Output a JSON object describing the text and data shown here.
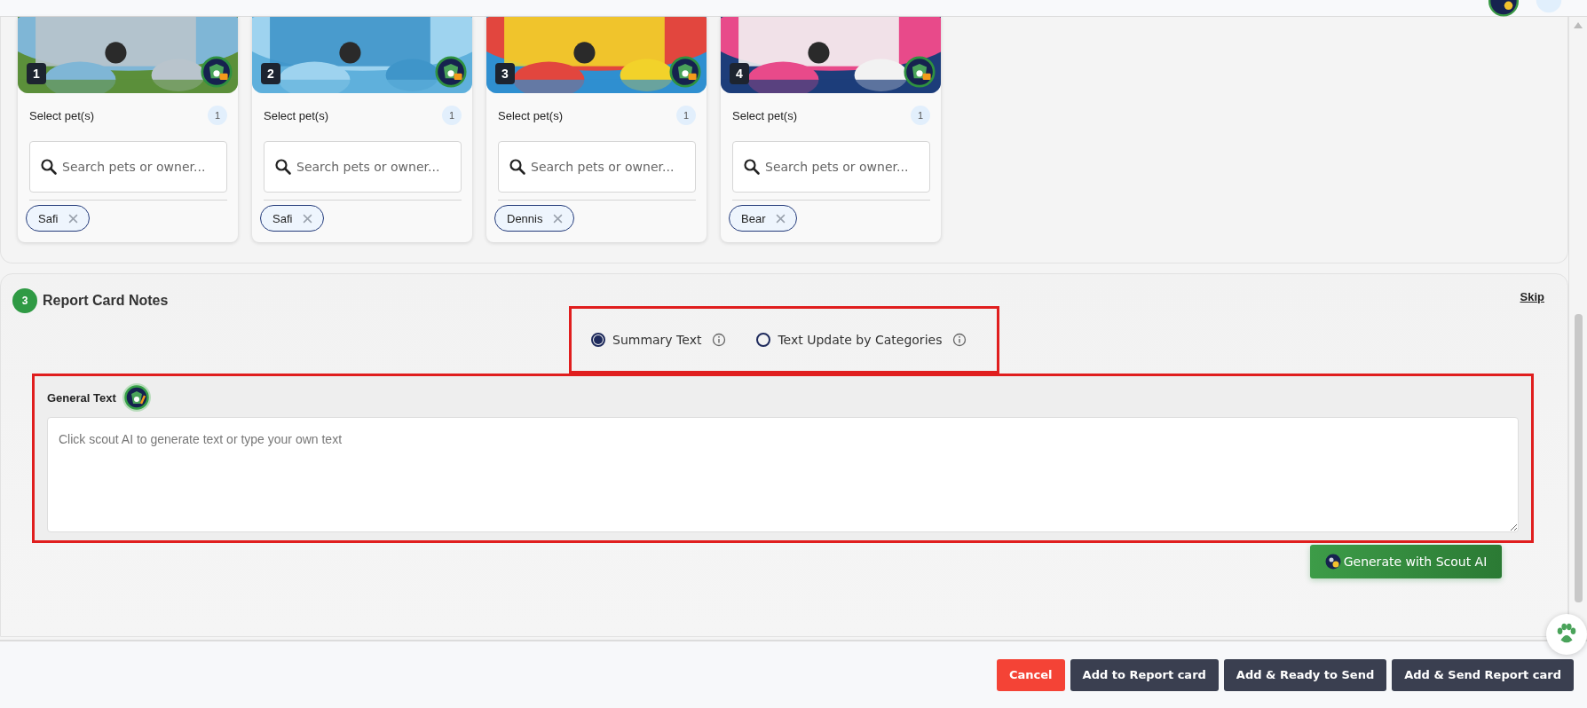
{
  "cards": [
    {
      "number": "1",
      "label": "Select pet(s)",
      "count": "1",
      "search": {
        "placeholder": "Search pets or owner..."
      },
      "tags": [
        {
          "name": "Safi"
        }
      ]
    },
    {
      "number": "2",
      "label": "Select pet(s)",
      "count": "1",
      "search": {
        "placeholder": "Search pets or owner..."
      },
      "tags": [
        {
          "name": "Safi"
        }
      ]
    },
    {
      "number": "3",
      "label": "Select pet(s)",
      "count": "1",
      "search": {
        "placeholder": "Search pets or owner..."
      },
      "tags": [
        {
          "name": "Dennis"
        }
      ]
    },
    {
      "number": "4",
      "label": "Select pet(s)",
      "count": "1",
      "search": {
        "placeholder": "Search pets or owner..."
      },
      "tags": [
        {
          "name": "Bear"
        }
      ]
    }
  ],
  "notes": {
    "step": "3",
    "title": "Report Card Notes",
    "skip": "Skip",
    "options": [
      {
        "label": "Summary Text",
        "selected": true
      },
      {
        "label": "Text Update by Categories",
        "selected": false
      }
    ],
    "general_label": "General Text",
    "textarea": {
      "placeholder": "Click scout AI to generate text or type your own text"
    },
    "generate_button": "Generate with Scout AI"
  },
  "footer_buttons": [
    {
      "label": "Cancel",
      "kind": "danger"
    },
    {
      "label": "Add to Report card",
      "kind": "primary"
    },
    {
      "label": "Add & Ready to Send",
      "kind": "primary"
    },
    {
      "label": "Add & Send Report card",
      "kind": "primary"
    }
  ]
}
